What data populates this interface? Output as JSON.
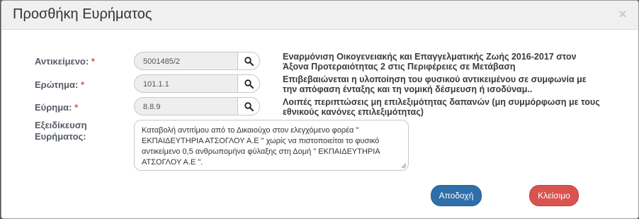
{
  "modal": {
    "title": "Προσθήκη Ευρήματος",
    "close_symbol": "×"
  },
  "fields": {
    "object": {
      "label": "Αντικείμενο:",
      "required_mark": "*",
      "value": "5001485/2",
      "description": "Εναρμόνιση Οικογενειακής και Επαγγελματικής Ζωής 2016-2017 στον Άξονα Προτεραιότητας 2 στις Περιφέρειες σε Μετάβαση"
    },
    "question": {
      "label": "Ερώτημα:",
      "required_mark": "*",
      "value": "101.1.1",
      "description": "Επιβεβαιώνεται η υλοποίηση του φυσικού αντικειμένου σε συμφωνία με την απόφαση ένταξης και τη νομική δέσμευση ή ισοδύναμ.."
    },
    "finding": {
      "label": "Εύρημα:",
      "required_mark": "*",
      "value": "8.8.9",
      "description": "Λοιπές περιπτώσεις μη επιλεξιμότητας δαπανών (μη συμμόρφωση με τους εθνικούς κανόνες επιλεξιμότητας)"
    },
    "specification": {
      "label_line1": "Εξειδίκευση",
      "label_line2": "Ευρήματος:",
      "value": "Καταβολή αντιτίμου από το Δικαιούχο στον ελεγχόμενο φορέα \" ΕΚΠΑΙΔΕΥΤΗΡΙΑ ΑΤΣΟΓΛΟΥ Α.Ε \" χωρίς να πιστοποιείται το φυσικό αντικείμενο 0,5 ανθρωπομήνα φύλαξης στη Δομή \" ΕΚΠΑΙΔΕΥΤΗΡΙΑ ΑΤΣΟΓΛΟΥ Α.Ε \"."
    }
  },
  "buttons": {
    "accept": "Αποδοχή",
    "close": "Κλείσιμο"
  },
  "icons": {
    "search": "search-icon",
    "close": "close-icon"
  },
  "colors": {
    "accept": "#2e6faa",
    "close": "#d9534f",
    "required": "#d9534f"
  }
}
